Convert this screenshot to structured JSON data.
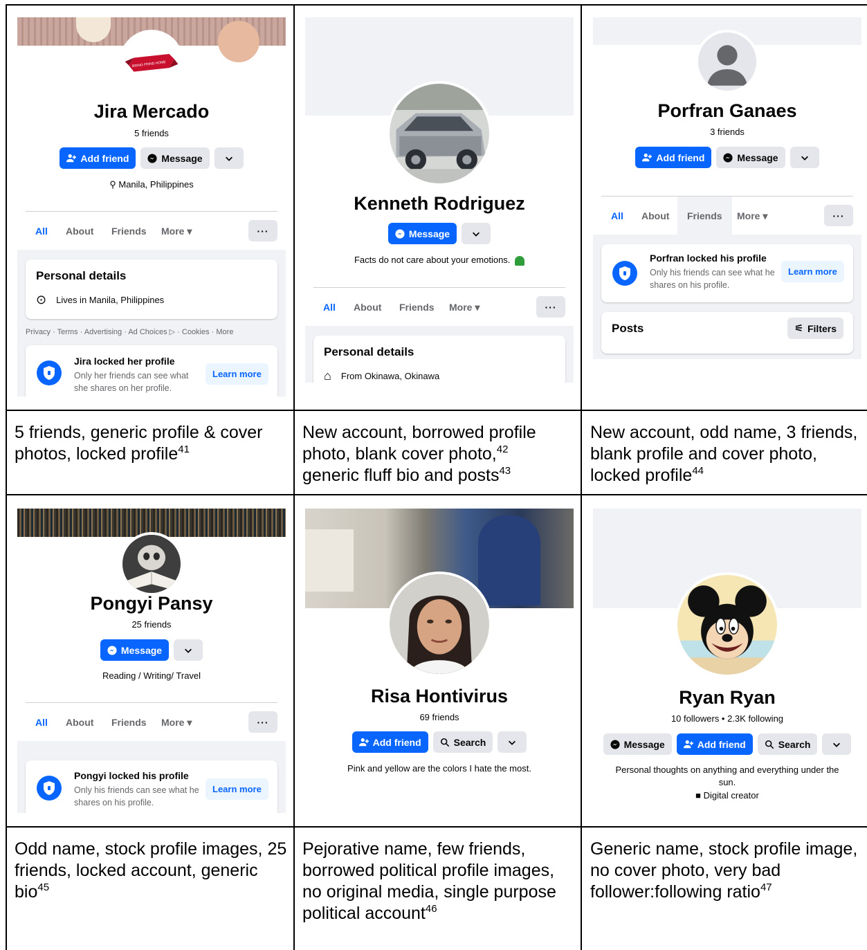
{
  "cells": [
    {
      "name": "Jira Mercado",
      "friends": "5 friends",
      "buttons": {
        "add_friend": "Add friend",
        "message": "Message"
      },
      "location": "Manila, Philippines",
      "tabs": [
        "All",
        "About",
        "Friends",
        "More"
      ],
      "personal_details_title": "Personal details",
      "detail": "Lives in Manila, Philippines",
      "footer": "Privacy · Terms · Advertising · Ad Choices ▷ · Cookies · More",
      "lock_title": "Jira locked her profile",
      "lock_text_1": "Only her friends can see what",
      "lock_text_2": "she shares on her profile.",
      "learn_more": "Learn more",
      "avatar_banner_text": "BRING FRIND HOME",
      "caption": "5 friends, generic profile & cover photos, locked profile",
      "footnote": "41"
    },
    {
      "name": "Kenneth Rodriguez",
      "buttons": {
        "message": "Message"
      },
      "bio": "Facts do not care about your emotions.",
      "tabs": [
        "All",
        "About",
        "Friends",
        "More"
      ],
      "personal_details_title": "Personal details",
      "detail": "From Okinawa, Okinawa",
      "caption_lines": [
        "New account, borrowed profile",
        "photo, blank cover photo,",
        "generic fluff bio and posts"
      ],
      "footnotes": [
        "42",
        "43"
      ]
    },
    {
      "name": "Porfran Ganaes",
      "friends": "3 friends",
      "buttons": {
        "add_friend": "Add friend",
        "message": "Message"
      },
      "tabs": [
        "All",
        "About",
        "Friends",
        "More"
      ],
      "lock_title": "Porfran locked his profile",
      "lock_text_1": "Only his friends can see what he",
      "lock_text_2": "shares on his profile.",
      "learn_more": "Learn more",
      "posts": "Posts",
      "filters": "Filters",
      "caption": "New account, odd name, 3 friends, blank profile and cover photo, locked profile",
      "footnote": "44"
    },
    {
      "name": "Pongyi Pansy",
      "friends": "25 friends",
      "buttons": {
        "message": "Message"
      },
      "bio": "Reading / Writing/ Travel",
      "tabs": [
        "All",
        "About",
        "Friends",
        "More"
      ],
      "lock_title": "Pongyi locked his profile",
      "lock_text_1": "Only his friends can see what he",
      "lock_text_2": "shares on his profile.",
      "learn_more": "Learn more",
      "caption": "Odd name, stock profile images, 25 friends, locked account, generic bio",
      "footnote": "45"
    },
    {
      "name": "Risa Hontivirus",
      "friends": "69 friends",
      "buttons": {
        "add_friend": "Add friend",
        "search": "Search"
      },
      "bio": "Pink and yellow are the colors I hate the most.",
      "caption": "Pejorative name, few friends, borrowed political profile images, no original media, single purpose political account",
      "footnote": "46"
    },
    {
      "name": "Ryan Ryan",
      "followers": "10 followers • 2.3K following",
      "buttons": {
        "message": "Message",
        "add_friend": "Add friend",
        "search": "Search"
      },
      "bio_1": "Personal thoughts on anything and everything under the",
      "bio_2": "sun.",
      "category": "Digital creator",
      "caption": "Generic name, stock profile image, no cover photo, very bad follower:following ratio",
      "footnote": "47"
    }
  ],
  "colors": {
    "facebook_blue": "#0866ff",
    "button_grey": "#e4e6eb",
    "feed_bg": "#f0f2f5"
  }
}
